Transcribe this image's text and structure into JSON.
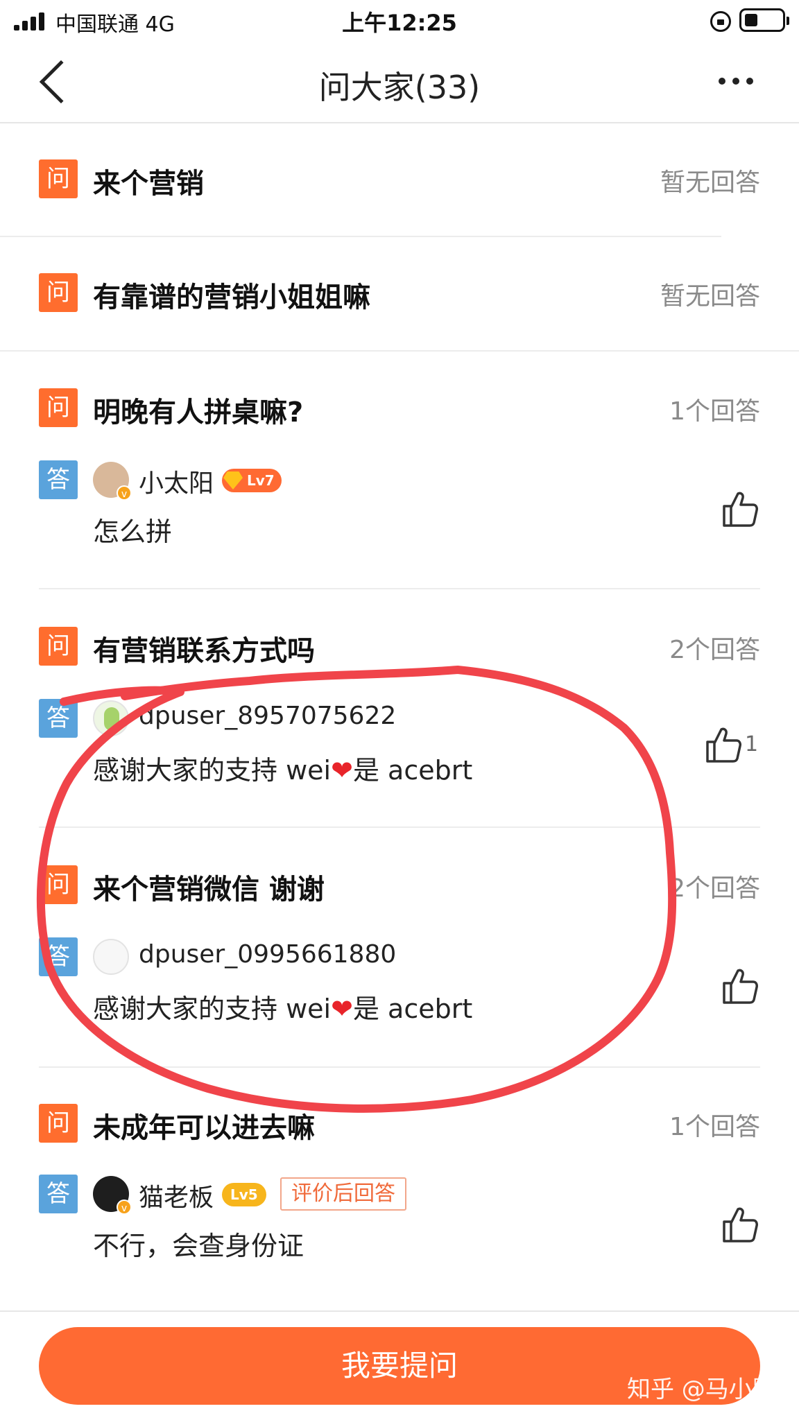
{
  "status": {
    "carrier": "中国联通  4G",
    "time": "上午12:25"
  },
  "nav": {
    "title": "问大家(33)"
  },
  "labels": {
    "question_badge": "问",
    "answer_badge": "答"
  },
  "questions": [
    {
      "title": "来个营销",
      "count": "暂无回答"
    },
    {
      "title": "有靠谱的营销小姐姐嘛",
      "count": "暂无回答"
    },
    {
      "title": "明晚有人拼桌嘛?",
      "count": "1个回答",
      "answer": {
        "user": "小太阳",
        "level": "Lv7",
        "text": "怎么拼",
        "likes": ""
      }
    },
    {
      "title": "有营销联系方式吗",
      "count": "2个回答",
      "answer": {
        "user": "dpuser_8957075622",
        "text_before": "感谢大家的支持 wei",
        "heart": "❤",
        "text_after": "是 acebrt",
        "likes": "1"
      }
    },
    {
      "title": "来个营销微信 谢谢",
      "count": "2个回答",
      "answer": {
        "user": "dpuser_0995661880",
        "text_before": "感谢大家的支持 wei",
        "heart": "❤",
        "text_after": "是 acebrt",
        "likes": ""
      }
    },
    {
      "title": "未成年可以进去嘛",
      "count": "1个回答",
      "answer": {
        "user": "猫老板",
        "level": "Lv5",
        "tag": "评价后回答",
        "text": "不行，会查身份证",
        "likes": ""
      }
    }
  ],
  "bottom": {
    "ask_button": "我要提问",
    "watermark": "知乎 @马小跳"
  },
  "colors": {
    "accent_orange": "#ff6a33",
    "question_badge": "#ff6d2e",
    "answer_badge": "#5aa3dc",
    "annotation_red": "#f0444a"
  }
}
